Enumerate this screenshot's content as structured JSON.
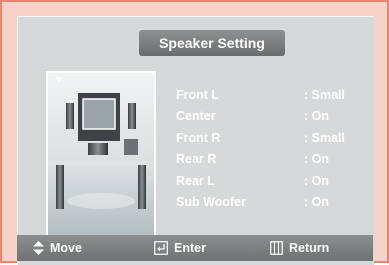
{
  "title": "Speaker Setting",
  "settings": [
    {
      "label": "Front L",
      "value": ": Small"
    },
    {
      "label": "Center",
      "value": ": On"
    },
    {
      "label": "Front R",
      "value": ": Small"
    },
    {
      "label": "Rear R",
      "value": ": On"
    },
    {
      "label": "Rear L",
      "value": ": On"
    },
    {
      "label": "Sub Woofer",
      "value": ": On"
    }
  ],
  "footer": {
    "move_label": "Move",
    "enter_label": "Enter",
    "return_label": "Return",
    "move_icon": "up-down-arrow-icon",
    "enter_icon": "enter-icon",
    "return_icon": "return-icon"
  }
}
